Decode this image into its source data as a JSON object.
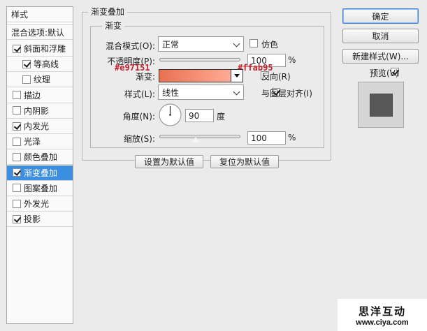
{
  "left_panel": {
    "header": "样式",
    "blend_options": "混合选项:默认",
    "items": [
      {
        "label": "斜面和浮雕",
        "checked": true,
        "indent": 0,
        "selected": false
      },
      {
        "label": "等高线",
        "checked": true,
        "indent": 1,
        "selected": false
      },
      {
        "label": "纹理",
        "checked": false,
        "indent": 1,
        "selected": false
      },
      {
        "label": "描边",
        "checked": false,
        "indent": 0,
        "selected": false
      },
      {
        "label": "内阴影",
        "checked": false,
        "indent": 0,
        "selected": false
      },
      {
        "label": "内发光",
        "checked": true,
        "indent": 0,
        "selected": false
      },
      {
        "label": "光泽",
        "checked": false,
        "indent": 0,
        "selected": false
      },
      {
        "label": "颜色叠加",
        "checked": false,
        "indent": 0,
        "selected": false
      },
      {
        "label": "渐变叠加",
        "checked": true,
        "indent": 0,
        "selected": true
      },
      {
        "label": "图案叠加",
        "checked": false,
        "indent": 0,
        "selected": false
      },
      {
        "label": "外发光",
        "checked": false,
        "indent": 0,
        "selected": false
      },
      {
        "label": "投影",
        "checked": true,
        "indent": 0,
        "selected": false
      }
    ]
  },
  "main": {
    "outer_title": "渐变叠加",
    "inner_title": "渐变",
    "blend_mode": {
      "label": "混合模式(O):",
      "value": "正常"
    },
    "dither": {
      "label": "仿色",
      "checked": false
    },
    "opacity": {
      "label": "不透明度(P):",
      "value": "100",
      "unit": "%",
      "level": 1.0
    },
    "gradient": {
      "label": "渐变:",
      "start_color": "#e97151",
      "end_color": "#ffab95"
    },
    "reverse": {
      "label": "反向(R)",
      "checked": false
    },
    "style": {
      "label": "样式(L):",
      "value": "线性"
    },
    "align_with_layer": {
      "label": "与图层对齐(I)",
      "checked": true
    },
    "angle": {
      "label": "角度(N):",
      "value": "90",
      "unit": "度",
      "degrees": 90
    },
    "scale": {
      "label": "缩放(S):",
      "value": "100",
      "unit": "%",
      "level": 0.45
    },
    "make_default": "设置为默认值",
    "reset_default": "复位为默认值",
    "annotations": {
      "start": "#e97151",
      "end": "#ffab95"
    }
  },
  "right_panel": {
    "ok": "确定",
    "cancel": "取消",
    "new_style": "新建样式(W)...",
    "preview": {
      "label": "预览(V)",
      "checked": true
    }
  },
  "watermark": {
    "title": "思洋互动",
    "url": "www.ciya.com"
  },
  "colors": {
    "accent": "#3b8ee0",
    "annotation": "#c51f2a"
  }
}
